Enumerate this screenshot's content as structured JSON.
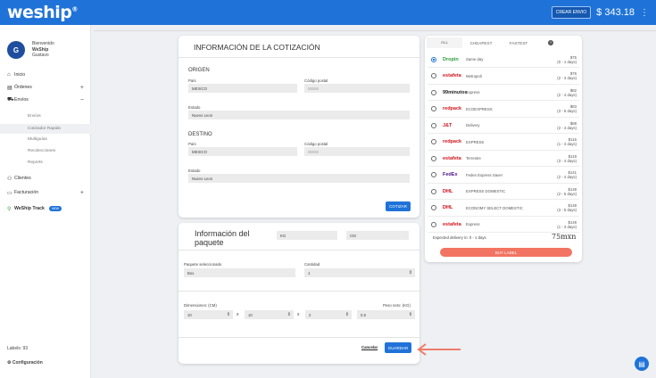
{
  "brand": {
    "logo": "weship",
    "balance": "$ 343.18",
    "crear_envio": "CREAR ENVIO"
  },
  "user": {
    "initial": "G",
    "greeting": "Bienvenido",
    "company": "WeShip",
    "name": "Gustavo"
  },
  "nav": {
    "inicio": "Inicio",
    "ordenes": "Órdenes",
    "envios": "Envíos",
    "sub": [
      "Envíos",
      "Cotizador Rapido",
      "Multiguías",
      "Recolecciones",
      "Reports"
    ],
    "clientes": "Clientes",
    "facturacion": "Facturación",
    "track": "WeShip Track",
    "new": "NEW",
    "labels": "Labels: 93",
    "config": "Configuración"
  },
  "quote": {
    "title": "INFORMACIÓN DE LA COTIZACIÓN",
    "origen": "ORIGEN",
    "destino": "DESTINO",
    "pais": "País",
    "cp": "Código postal",
    "estado": "Estado",
    "origen_pais": "MEXICO",
    "origen_estado": "Nuevo Leon",
    "destino_pais": "MEXICO",
    "destino_estado": "Nuevo Leon",
    "cotizar": "COTIZAR"
  },
  "package": {
    "title1": "Información del",
    "title2": "paquete",
    "kg": "KG",
    "cm": "CM",
    "paquete_sel": "Paquete seleccionado",
    "paquete_val": "Box",
    "cantidad": "Cantidad",
    "cantidad_val": "1",
    "dims": "Dimensiones: (CM)",
    "peso": "Peso neto: (KG)",
    "d1": "10",
    "d2": "10",
    "d3": "2",
    "weight": "0.5",
    "x": "x",
    "cancel": "Cancelar",
    "save": "GUARDAR"
  },
  "rates": {
    "tabs": [
      "ALL",
      "CHEAPEST",
      "FASTEST"
    ],
    "delivery": "Expected delivery in: 0 - 1 days",
    "total": "75mxn",
    "buy": "BUY LABEL",
    "items": [
      {
        "logo": "Dropin",
        "color": "#2e9e3a",
        "service": "Same day",
        "price": "$75",
        "days": "(0 - 1 days)"
      },
      {
        "logo": "estafeta",
        "color": "#d0141c",
        "service": "Metropoli",
        "price": "$76",
        "days": "(2 - 3 days)"
      },
      {
        "logo": "99minutos",
        "color": "#222222",
        "service": "Express",
        "price": "$82",
        "days": "(2 - 4 days)"
      },
      {
        "logo": "redpack",
        "color": "#d0141c",
        "service": "ECOEXPRESS",
        "price": "$83",
        "days": "(3 - 5 days)"
      },
      {
        "logo": "J&T",
        "color": "#d0141c",
        "service": "Delivery",
        "price": "$88",
        "days": "(2 - 4 days)"
      },
      {
        "logo": "redpack",
        "color": "#d0141c",
        "service": "EXPRESS",
        "price": "$116",
        "days": "(1 - 4 days)"
      },
      {
        "logo": "estafeta",
        "color": "#d0141c",
        "service": "Terrestre",
        "price": "$119",
        "days": "(3 - 4 days)"
      },
      {
        "logo": "FedEx",
        "color": "#4d148c",
        "service": "Fedex Express Saver",
        "price": "$141",
        "days": "(2 - 4 days)"
      },
      {
        "logo": "DHL",
        "color": "#d40511",
        "service": "EXPRESS DOMESTIC",
        "price": "$148",
        "days": "(2 - 5 days)"
      },
      {
        "logo": "DHL",
        "color": "#d40511",
        "service": "ECONOMY SELECT DOMESTIC",
        "price": "$148",
        "days": "(3 - 5 days)"
      },
      {
        "logo": "estafeta",
        "color": "#d0141c",
        "service": "Express",
        "price": "$149",
        "days": "(1 - 3 days)"
      }
    ]
  }
}
